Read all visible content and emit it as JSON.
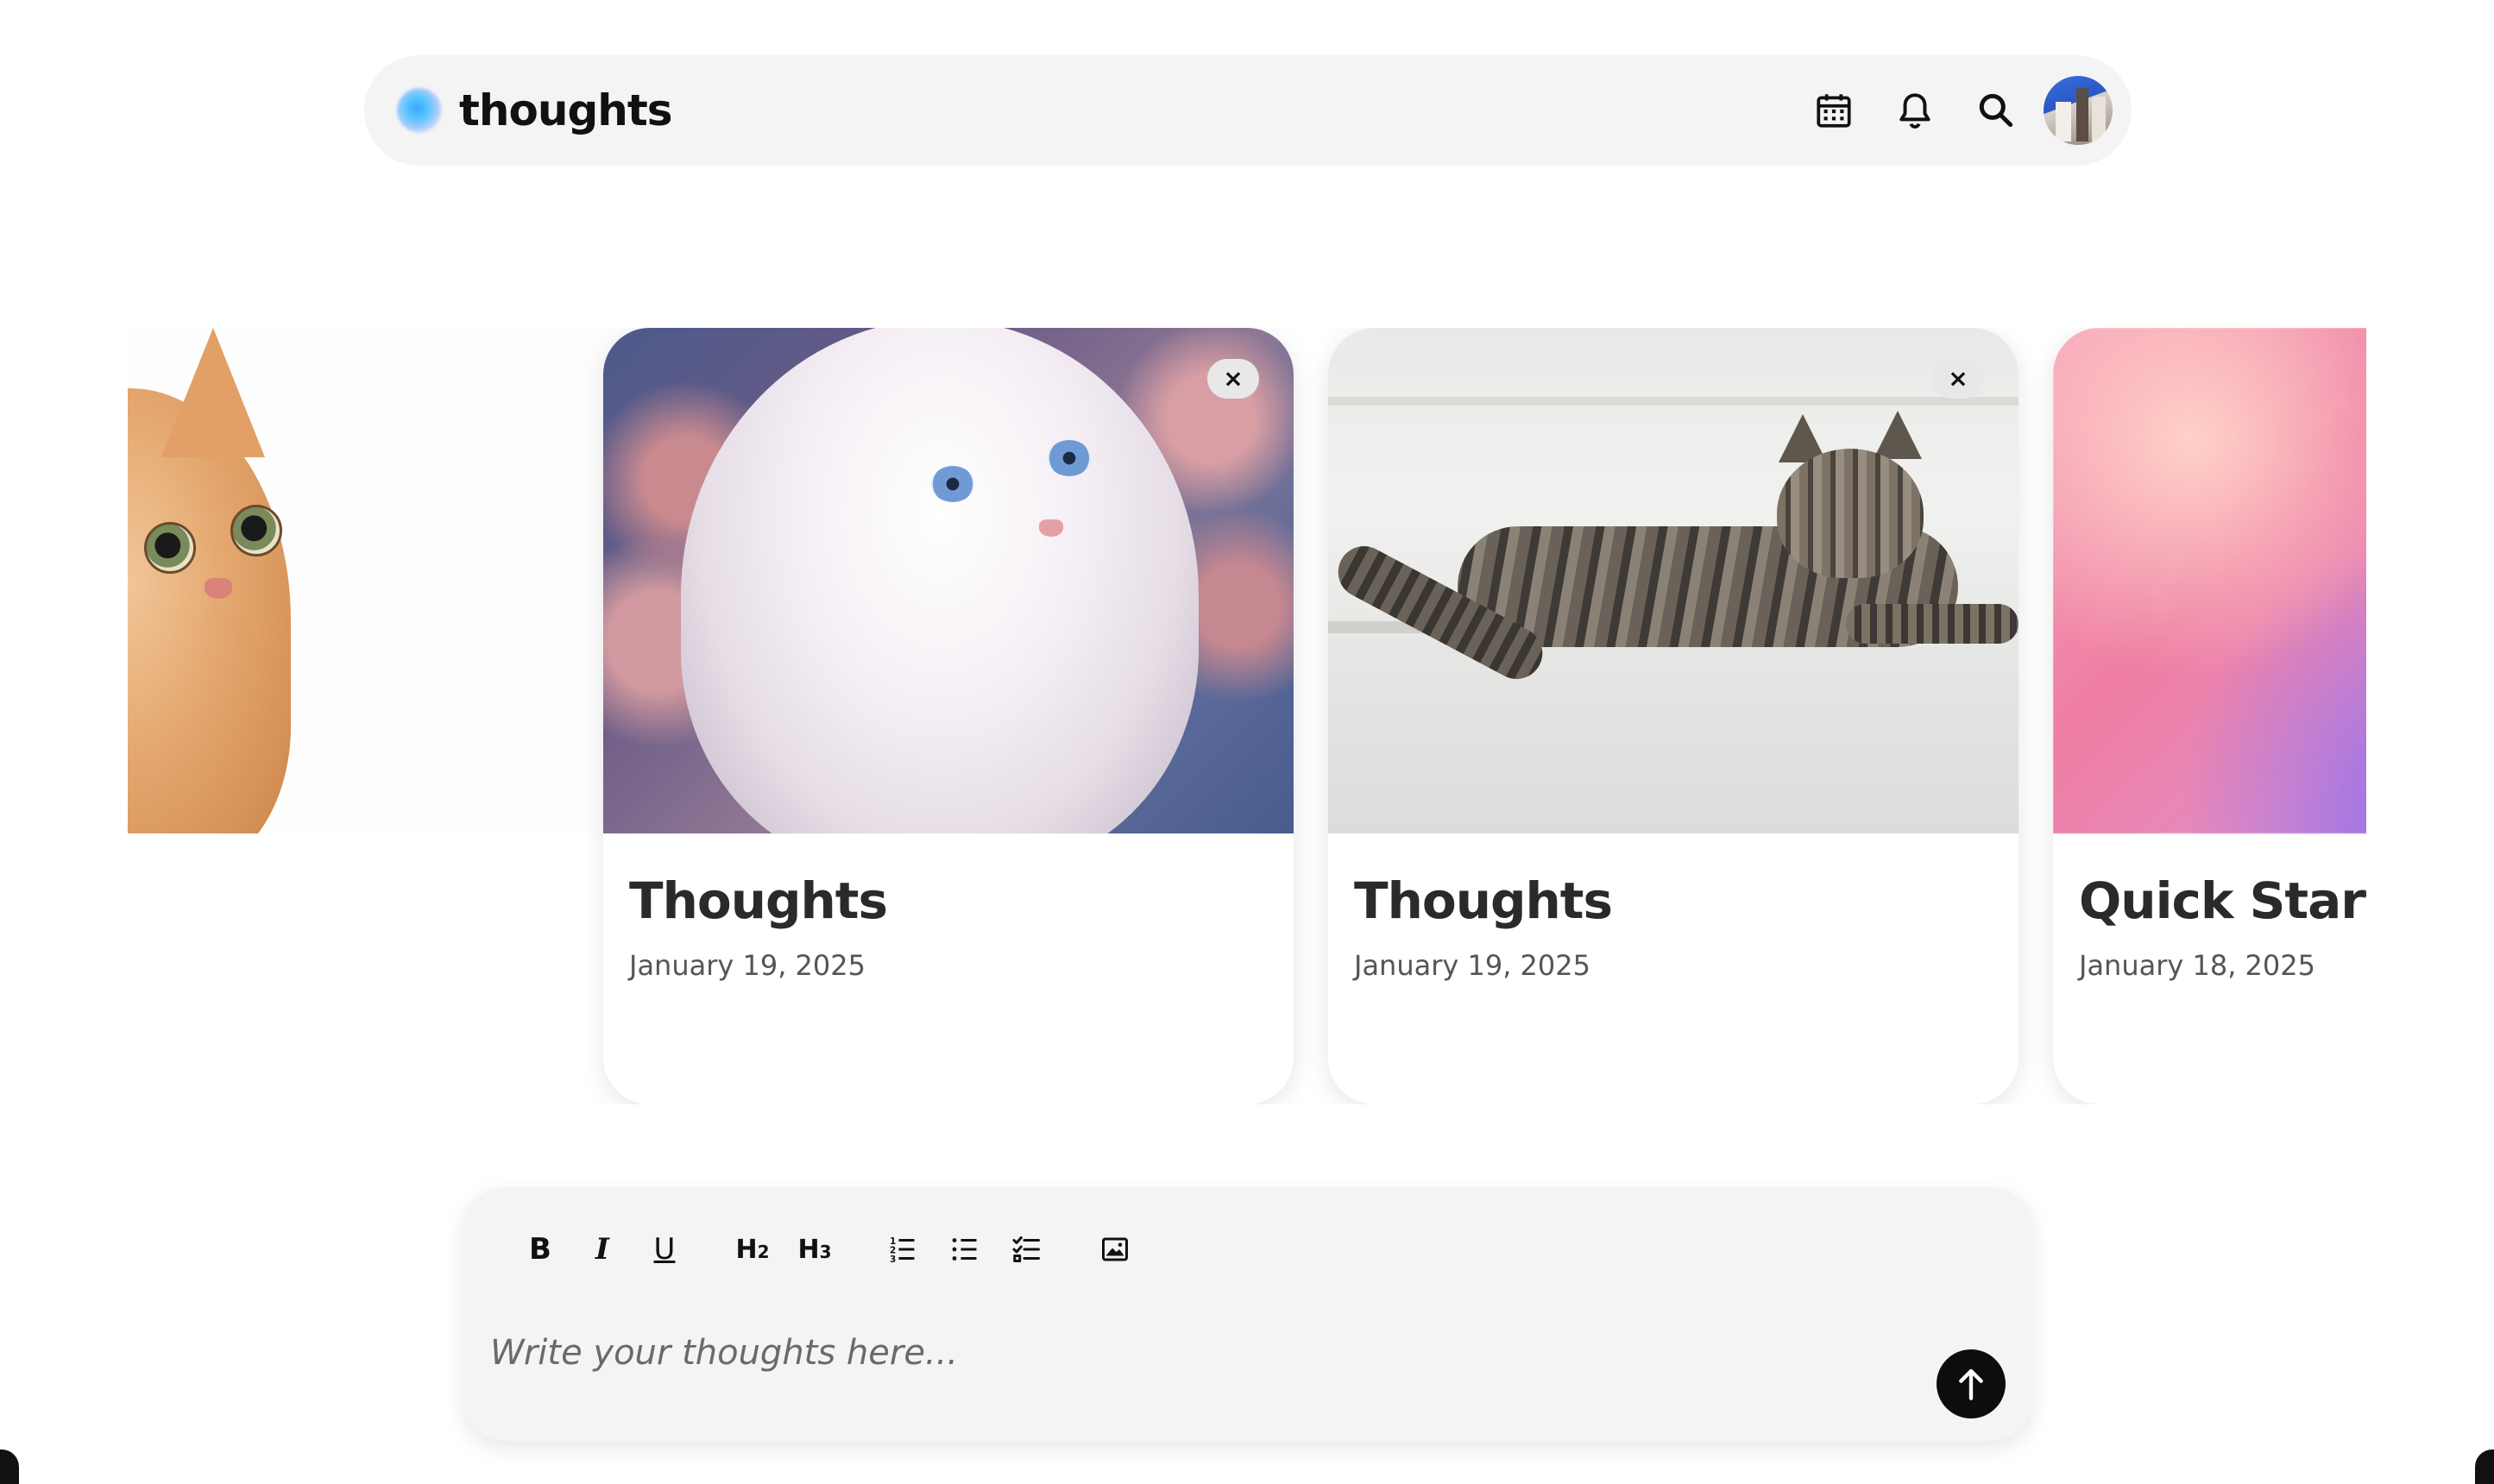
{
  "app": {
    "name": "thoughts"
  },
  "header": {
    "icons": [
      "calendar-icon",
      "bell-icon",
      "search-icon",
      "avatar"
    ]
  },
  "cards": [
    {
      "title": "",
      "date": "",
      "image": "orange-tabby-cat",
      "close_label": "×"
    },
    {
      "title": "Thoughts",
      "date": "January 19, 2025",
      "image": "white-fluffy-cat",
      "close_label": "×"
    },
    {
      "title": "Thoughts",
      "date": "January 19, 2025",
      "image": "tabby-cat-on-wall",
      "close_label": "×"
    },
    {
      "title": "Quick Start",
      "date": "January 18, 2025",
      "image": "pink-purple-gradient"
    }
  ],
  "editor": {
    "toolbar": {
      "bold": "B",
      "italic": "I",
      "underline": "U",
      "h2": "H",
      "h2_sub": "2",
      "h3": "H",
      "h3_sub": "3",
      "icons": [
        "ordered-list-icon",
        "bullet-list-icon",
        "checklist-icon",
        "image-icon"
      ]
    },
    "placeholder": "Write your thoughts here...",
    "value": "",
    "send_icon": "arrow-up-icon"
  },
  "colors": {
    "header_bg": "#f4f4f4",
    "editor_bg": "#f4f4f4",
    "send_button": "#0d0d0d",
    "text_dark": "#2a2a2a",
    "text_muted": "#555555"
  }
}
